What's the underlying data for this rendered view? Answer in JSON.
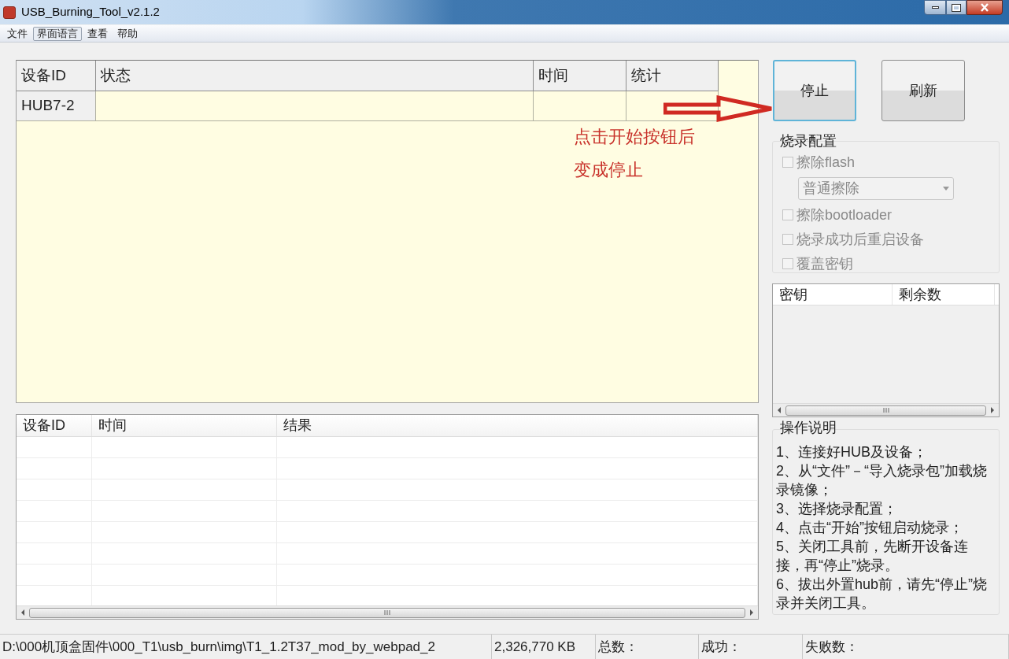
{
  "window": {
    "title": "USB_Burning_Tool_v2.1.2"
  },
  "menu": [
    {
      "label": "文件",
      "selected": false
    },
    {
      "label": "界面语言",
      "selected": true
    },
    {
      "label": "查看",
      "selected": false
    },
    {
      "label": "帮助",
      "selected": false
    }
  ],
  "device_table": {
    "columns": [
      "设备ID",
      "状态",
      "时间",
      "统计"
    ],
    "rows": [
      [
        "HUB7-2",
        "",
        "",
        ""
      ]
    ]
  },
  "annotation": {
    "lines": [
      "点击开始按钮后",
      "变成停止"
    ]
  },
  "log_table": {
    "columns": [
      "设备ID",
      "时间",
      "结果"
    ]
  },
  "buttons": [
    {
      "label": "停止",
      "focused": true
    },
    {
      "label": "刷新",
      "focused": false
    }
  ],
  "burn_config": {
    "title": "烧录配置",
    "options": [
      {
        "kind": "checkbox",
        "label": "擦除flash",
        "checked": false,
        "disabled": true
      },
      {
        "kind": "dropdown",
        "value": "普通擦除",
        "disabled": true
      },
      {
        "kind": "checkbox",
        "label": "擦除bootloader",
        "checked": false,
        "disabled": true
      },
      {
        "kind": "checkbox",
        "label": "烧录成功后重启设备",
        "checked": false,
        "disabled": true
      },
      {
        "kind": "checkbox",
        "label": "覆盖密钥",
        "checked": false,
        "disabled": true
      }
    ]
  },
  "key_table": {
    "columns": [
      "密钥",
      "剩余数"
    ]
  },
  "instructions": {
    "title": "操作说明",
    "text": "1、连接好HUB及设备；\n2、从“文件”－“导入烧录包”加载烧录镜像；\n3、选择烧录配置；\n4、点击“开始”按钮启动烧录；\n5、关闭工具前，先断开设备连接，再“停止”烧录。\n6、拔出外置hub前，请先“停止”烧录并关闭工具。"
  },
  "status_bar": [
    "D:\\000机顶盒固件\\000_T1\\usb_burn\\img\\T1_1.2T37_mod_by_webpad_2",
    "2,326,770 KB",
    "总数：",
    "成功：",
    "失败数："
  ]
}
